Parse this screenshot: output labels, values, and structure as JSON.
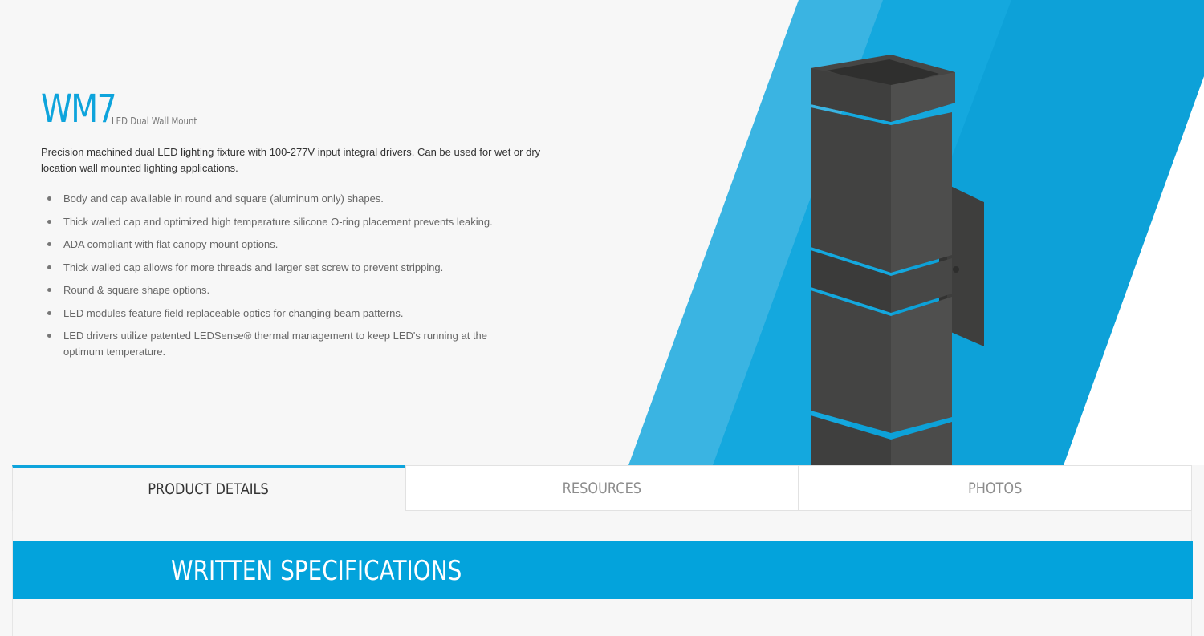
{
  "product": {
    "code": "WM7",
    "subtitle": "LED Dual Wall Mount",
    "description": "Precision machined dual LED lighting fixture with 100-277V input integral drivers. Can be used for wet or dry location wall mounted lighting applications.",
    "features": [
      "Body and cap available in round and square (aluminum only) shapes.",
      "Thick walled cap and optimized high temperature silicone O-ring placement prevents leaking.",
      "ADA compliant with flat canopy mount options.",
      "Thick walled cap allows for more threads and larger set screw to prevent stripping.",
      "Round & square shape options.",
      "LED modules feature field replaceable optics for changing beam patterns.",
      "LED drivers utilize patented LEDSense® thermal management to keep LED's running at the optimum temperature."
    ]
  },
  "tabs": [
    {
      "label": "PRODUCT DETAILS",
      "active": true
    },
    {
      "label": "RESOURCES",
      "active": false
    },
    {
      "label": "PHOTOS",
      "active": false
    }
  ],
  "section": {
    "title": "WRITTEN SPECIFICATIONS"
  },
  "colors": {
    "accent": "#0ea4dc",
    "stripe_light": "#3ab4e2",
    "stripe_dark": "#079bd4",
    "fixture": "#4a4a49"
  }
}
